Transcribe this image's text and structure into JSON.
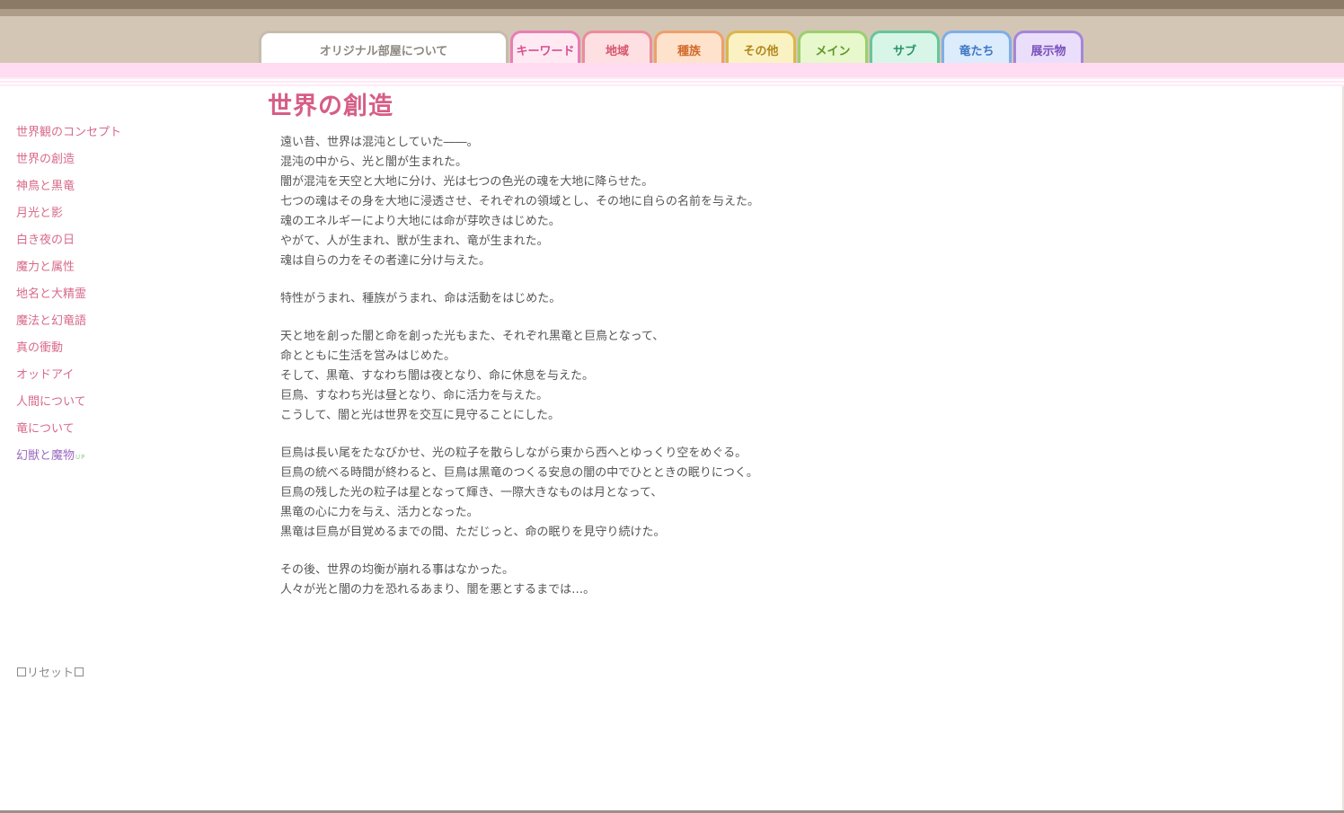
{
  "tabs": {
    "about": "オリジナル部屋について",
    "keyword": "キーワード",
    "region": "地域",
    "tribe": "種族",
    "other": "その他",
    "main": "メイン",
    "sub": "サブ",
    "dragons": "竜たち",
    "exhibit": "展示物"
  },
  "sidebar": {
    "items": [
      "世界観のコンセプト",
      "世界の創造",
      "神鳥と黒竜",
      "月光と影",
      "白き夜の日",
      "魔力と属性",
      "地名と大精霊",
      "魔法と幻竜語",
      "真の衝動",
      "オッドアイ",
      "人間について",
      "竜について",
      "幻獣と魔物"
    ],
    "up_badge": "UP",
    "reset": "リセット"
  },
  "page": {
    "title": "世界の創造",
    "paragraphs": [
      [
        "遠い昔、世界は混沌としていた――。",
        "混沌の中から、光と闇が生まれた。",
        "闇が混沌を天空と大地に分け、光は七つの色光の魂を大地に降らせた。",
        "七つの魂はその身を大地に浸透させ、それぞれの領域とし、その地に自らの名前を与えた。",
        "魂のエネルギーにより大地には命が芽吹きはじめた。",
        "やがて、人が生まれ、獣が生まれ、竜が生まれた。",
        "魂は自らの力をその者達に分け与えた。"
      ],
      [
        "特性がうまれ、種族がうまれ、命は活動をはじめた。"
      ],
      [
        "天と地を創った闇と命を創った光もまた、それぞれ黒竜と巨鳥となって、",
        "命とともに生活を営みはじめた。",
        "そして、黒竜、すなわち闇は夜となり、命に休息を与えた。",
        "巨鳥、すなわち光は昼となり、命に活力を与えた。",
        "こうして、闇と光は世界を交互に見守ることにした。"
      ],
      [
        "巨鳥は長い尾をたなびかせ、光の粒子を散らしながら東から西へとゆっくり空をめぐる。",
        "巨鳥の統べる時間が終わると、巨鳥は黒竜のつくる安息の闇の中でひとときの眠りにつく。",
        "巨鳥の残した光の粒子は星となって輝き、一際大きなものは月となって、",
        "黒竜の心に力を与え、活力となった。",
        "黒竜は巨鳥が目覚めるまでの間、ただじっと、命の眠りを見守り続けた。"
      ],
      [
        "その後、世界の均衡が崩れる事はなかった。",
        "人々が光と闇の力を恐れるあまり、闇を悪とするまでは…。"
      ]
    ]
  },
  "colors": {
    "title": "#d65e86",
    "link": "#d86a8a",
    "link_new": "#9a6ac0",
    "pink_band": "#ffdcf2"
  }
}
